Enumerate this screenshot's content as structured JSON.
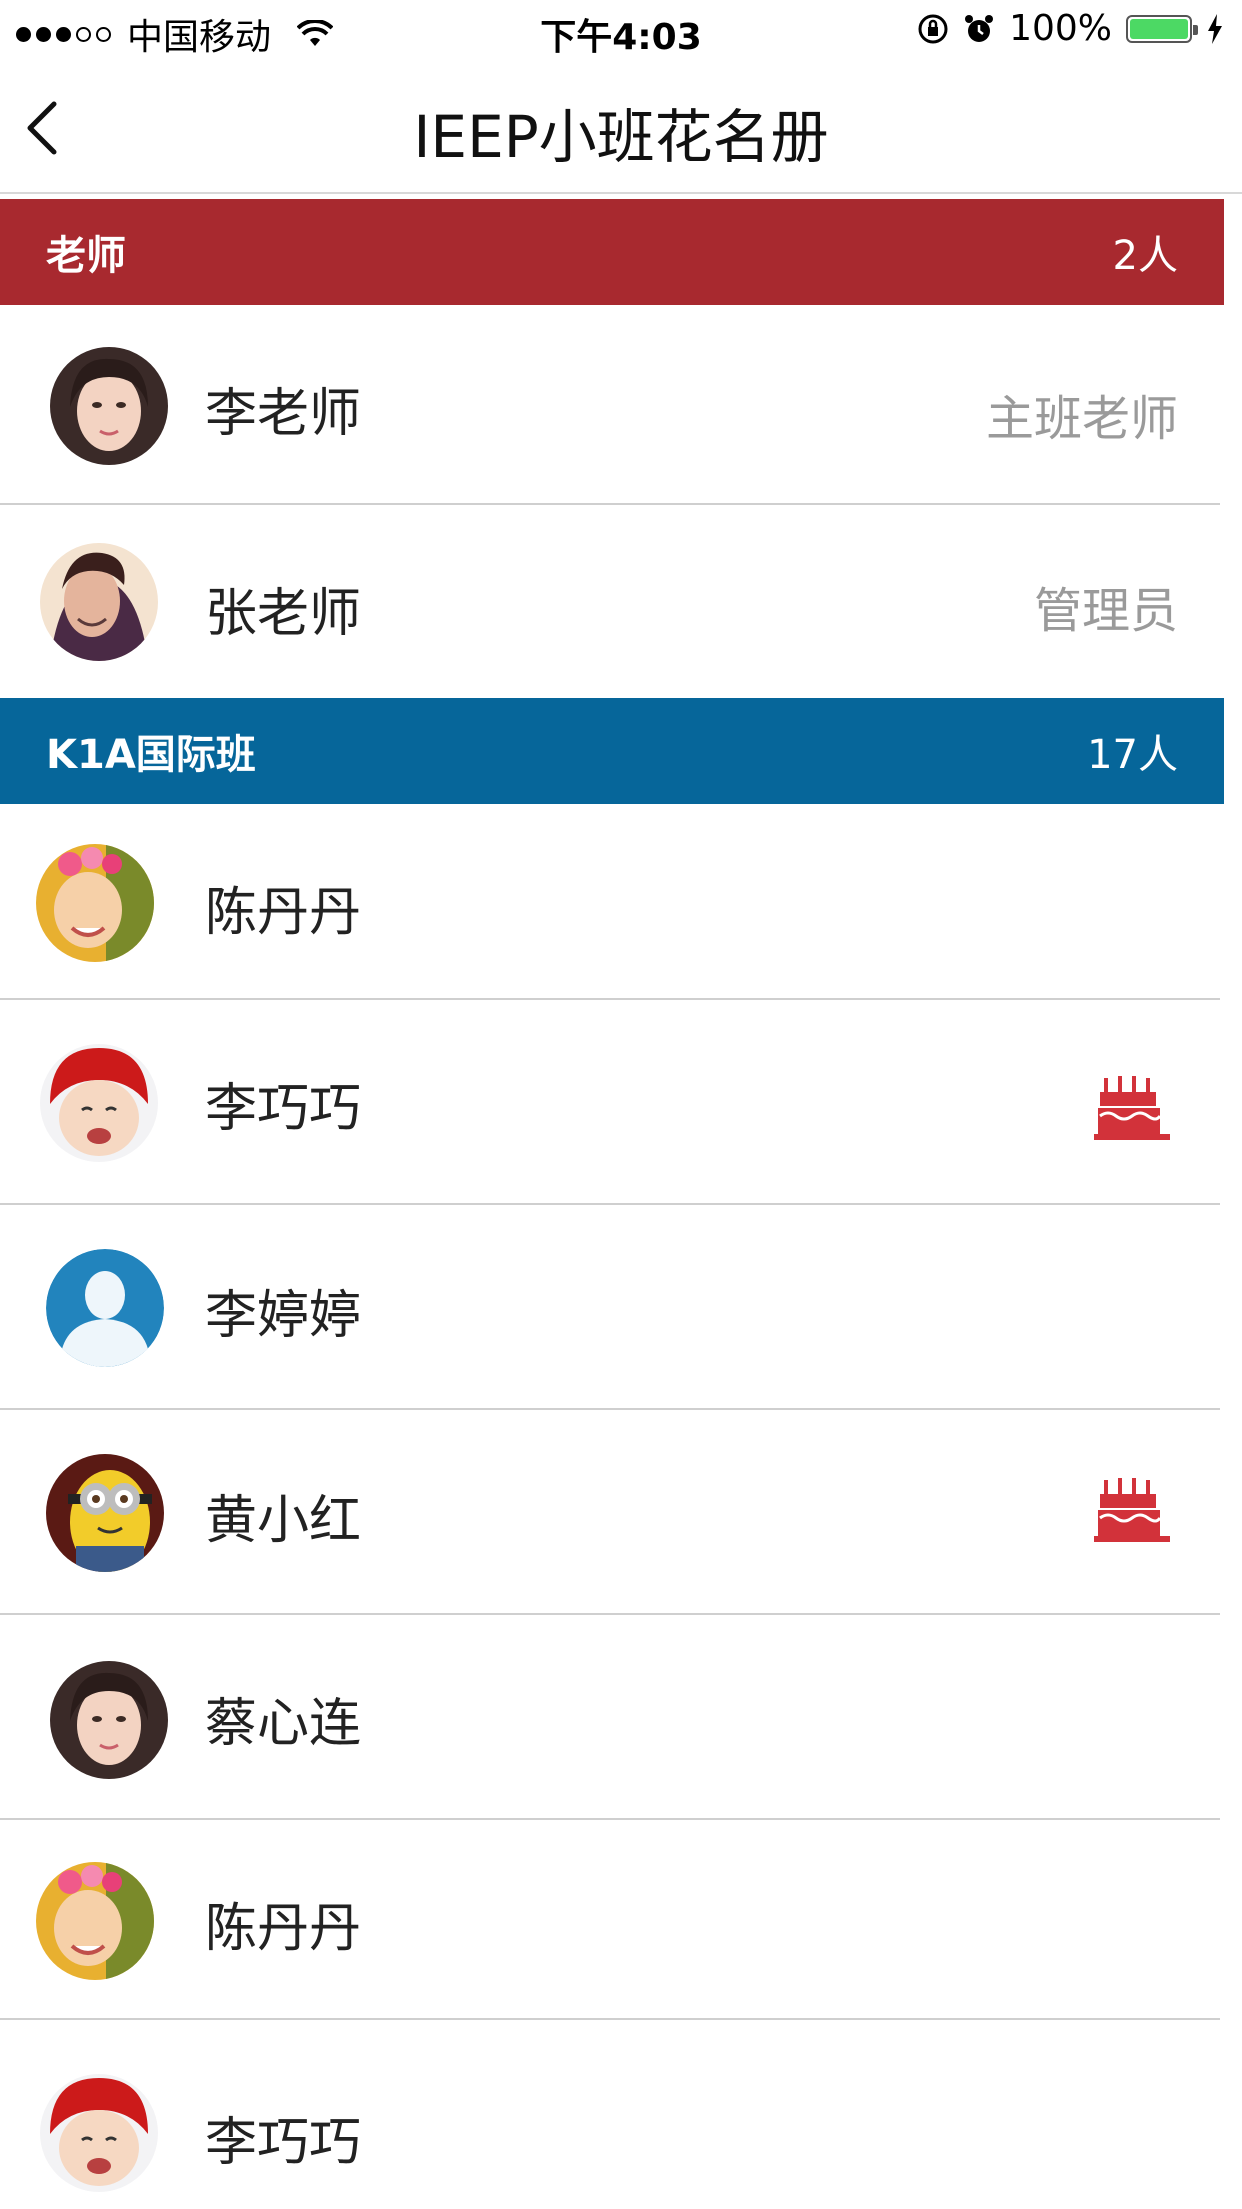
{
  "status_bar": {
    "carrier": "中国移动",
    "time": "下午4:03",
    "battery": "100%",
    "battery_level": 1.0
  },
  "nav": {
    "title": "IEEP小班花名册",
    "back_icon": "chevron-left-icon"
  },
  "sections": [
    {
      "title": "老师",
      "count": "2人",
      "color": "#a8292f",
      "members": [
        {
          "name": "李老师",
          "role": "主班老师",
          "avatar": "woman-photo"
        },
        {
          "name": "张老师",
          "role": "管理员",
          "avatar": "man-photo"
        }
      ]
    },
    {
      "title": "K1A国际班",
      "count": "17人",
      "color": "#06669a",
      "members": [
        {
          "name": "陈丹丹",
          "birthday": false,
          "avatar": "flower-girl-photo"
        },
        {
          "name": "李巧巧",
          "birthday": true,
          "avatar": "red-hat-kid-photo"
        },
        {
          "name": "李婷婷",
          "birthday": false,
          "avatar": "default-person-icon"
        },
        {
          "name": "黄小红",
          "birthday": true,
          "avatar": "minion-photo"
        },
        {
          "name": "蔡心连",
          "birthday": false,
          "avatar": "woman-photo"
        },
        {
          "name": "陈丹丹",
          "birthday": false,
          "avatar": "flower-girl-photo"
        },
        {
          "name": "李巧巧",
          "birthday": false,
          "avatar": "red-hat-kid-photo"
        }
      ]
    }
  ],
  "colors": {
    "birthday_icon": "#d2323a",
    "divider": "#cfcfcf",
    "role_text": "#9a9a9a"
  }
}
